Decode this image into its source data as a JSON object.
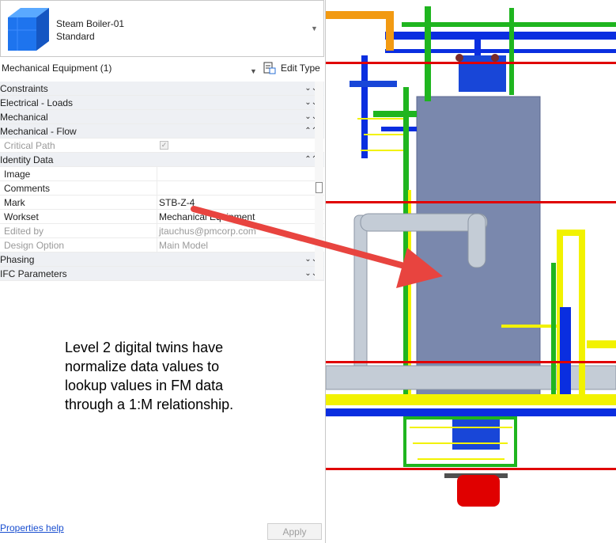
{
  "type_selector": {
    "family_name": "Steam Boiler-01",
    "type_name": "Standard"
  },
  "instance_filter": {
    "label": "Mechanical Equipment (1)",
    "edit_type_label": "Edit Type"
  },
  "groups": {
    "constraints": "Constraints",
    "electrical_loads": "Electrical - Loads",
    "mechanical": "Mechanical",
    "mechanical_flow": "Mechanical - Flow",
    "identity_data": "Identity Data",
    "phasing": "Phasing",
    "ifc_parameters": "IFC Parameters"
  },
  "properties": {
    "critical_path": {
      "label": "Critical Path",
      "checked": true
    },
    "image": {
      "label": "Image",
      "value": ""
    },
    "comments": {
      "label": "Comments",
      "value": ""
    },
    "mark": {
      "label": "Mark",
      "value": "STB-Z-4"
    },
    "workset": {
      "label": "Workset",
      "value": "Mechanical Equipment"
    },
    "edited_by": {
      "label": "Edited by",
      "value": "jtauchus@pmcorp.com"
    },
    "design_option": {
      "label": "Design Option",
      "value": "Main Model"
    }
  },
  "annotation": {
    "line1": "Level 2 digital twins have",
    "line2": "normalize data values to",
    "line3": "lookup values in FM data",
    "line4": "through a 1:M relationship."
  },
  "footer": {
    "help_link": "Properties help",
    "apply_label": "Apply"
  },
  "colors": {
    "accent_blue": "#0a2ee0",
    "pipe_green": "#1fb51f",
    "pipe_yellow": "#f2f200",
    "pipe_orange": "#f29a12",
    "level_line_red": "#e00000",
    "boiler_body": "#7a88ad",
    "callout_arrow": "#e8443f",
    "pipe_gray": "#c4ccd6"
  }
}
